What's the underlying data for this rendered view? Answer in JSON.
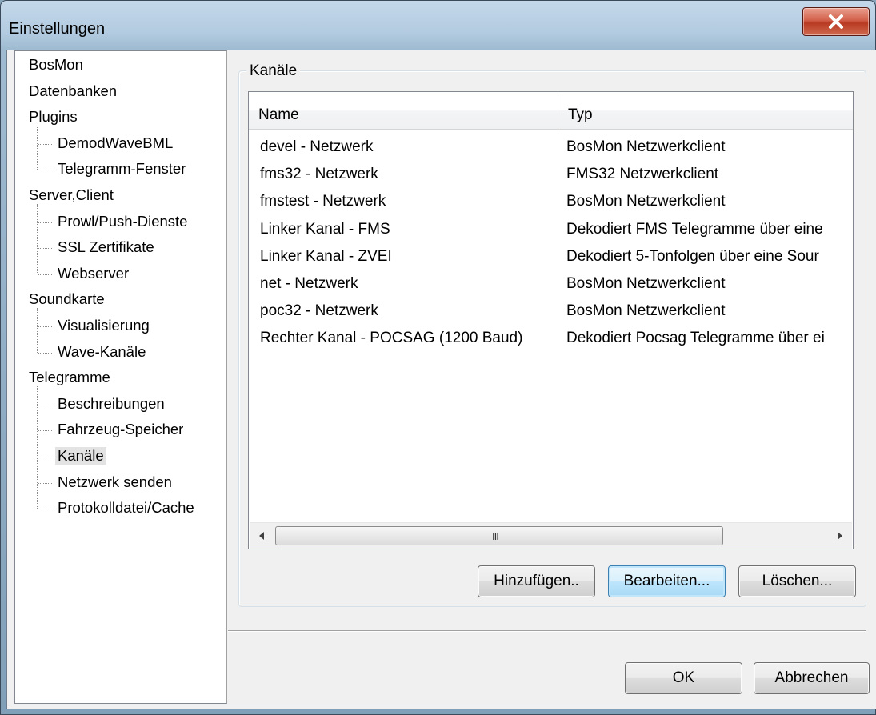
{
  "window": {
    "title": "Einstellungen"
  },
  "tree": {
    "items": [
      {
        "label": "BosMon",
        "level": 0
      },
      {
        "label": "Datenbanken",
        "level": 0
      },
      {
        "label": "Plugins",
        "level": 0
      },
      {
        "label": "DemodWaveBML",
        "level": 1
      },
      {
        "label": "Telegramm-Fenster",
        "level": 1
      },
      {
        "label": "Server,Client",
        "level": 0
      },
      {
        "label": "Prowl/Push-Dienste",
        "level": 1
      },
      {
        "label": "SSL Zertifikate",
        "level": 1
      },
      {
        "label": "Webserver",
        "level": 1
      },
      {
        "label": "Soundkarte",
        "level": 0
      },
      {
        "label": "Visualisierung",
        "level": 1
      },
      {
        "label": "Wave-Kanäle",
        "level": 1
      },
      {
        "label": "Telegramme",
        "level": 0
      },
      {
        "label": "Beschreibungen",
        "level": 1
      },
      {
        "label": "Fahrzeug-Speicher",
        "level": 1
      },
      {
        "label": "Kanäle",
        "level": 1,
        "selected": true
      },
      {
        "label": "Netzwerk senden",
        "level": 1
      },
      {
        "label": "Protokolldatei/Cache",
        "level": 1
      }
    ]
  },
  "group": {
    "label": "Kanäle"
  },
  "list": {
    "columns": [
      "Name",
      "Typ"
    ],
    "rows": [
      [
        "devel - Netzwerk",
        "BosMon Netzwerkclient"
      ],
      [
        "fms32 - Netzwerk",
        "FMS32 Netzwerkclient"
      ],
      [
        "fmstest - Netzwerk",
        "BosMon Netzwerkclient"
      ],
      [
        "Linker Kanal - FMS",
        "Dekodiert FMS Telegramme über eine"
      ],
      [
        "Linker Kanal - ZVEI",
        "Dekodiert 5-Tonfolgen über eine Sour"
      ],
      [
        "net - Netzwerk",
        "BosMon Netzwerkclient"
      ],
      [
        "poc32 - Netzwerk",
        "BosMon Netzwerkclient"
      ],
      [
        "Rechter Kanal - POCSAG (1200 Baud)",
        "Dekodiert Pocsag Telegramme über ei"
      ]
    ],
    "scrollbar_grip": "III"
  },
  "buttons": {
    "add": "Hinzufügen..",
    "edit": "Bearbeiten...",
    "delete": "Löschen...",
    "ok": "OK",
    "cancel": "Abbrechen"
  },
  "icons": {
    "close": "close-icon",
    "scroll_left": "arrow-left-icon",
    "scroll_right": "arrow-right-icon"
  },
  "colors": {
    "close_button": "#c9462c",
    "selection": "#e3e3e3",
    "focus_border": "#3c7fb1"
  }
}
